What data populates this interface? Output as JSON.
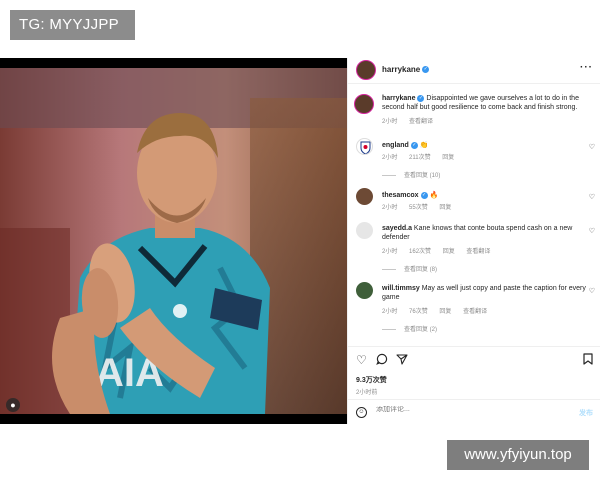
{
  "watermarks": {
    "top": "TG: MYYJJPP",
    "bottom": "www.yfyiyun.top"
  },
  "header": {
    "username": "harrykane"
  },
  "caption": {
    "username": "harrykane",
    "text": "Disappointed we gave ourselves a lot to do in the second half but good resilience to come back and finish strong.",
    "time": "2小时",
    "translate": "查看翻译"
  },
  "comments": [
    {
      "username": "england",
      "text": "👏",
      "time": "2小时",
      "likes": "211次赞",
      "reply": "回复",
      "translate": "",
      "replies": "查看回复 (10)"
    },
    {
      "username": "thesamcox",
      "text": "🔥",
      "time": "2小时",
      "likes": "55次赞",
      "reply": "回复",
      "translate": "",
      "replies": ""
    },
    {
      "username": "sayedd.a",
      "text": "Kane knows that conte bouta spend cash on a new defender",
      "time": "2小时",
      "likes": "162次赞",
      "reply": "回复",
      "translate": "查看翻译",
      "replies": "查看回复 (8)"
    },
    {
      "username": "will.timmsy",
      "text": "May as well just copy and paste the caption for every game",
      "time": "2小时",
      "likes": "76次赞",
      "reply": "回复",
      "translate": "查看翻译",
      "replies": "查看回复 (2)"
    }
  ],
  "stats": {
    "likes": "9.3万次赞",
    "posted": "2小时前"
  },
  "add_comment": {
    "placeholder": "添加评论...",
    "post_label": "发布"
  },
  "icons": {
    "like": "heart-icon",
    "comment": "comment-icon",
    "share": "share-icon",
    "save": "bookmark-icon",
    "emoji": "emoji-icon",
    "more": "more-icon",
    "tagged": "user-tag-icon"
  },
  "colors": {
    "accent": "#3897f0",
    "muted": "#8e8e8e",
    "jersey": "#2e9fb5"
  }
}
